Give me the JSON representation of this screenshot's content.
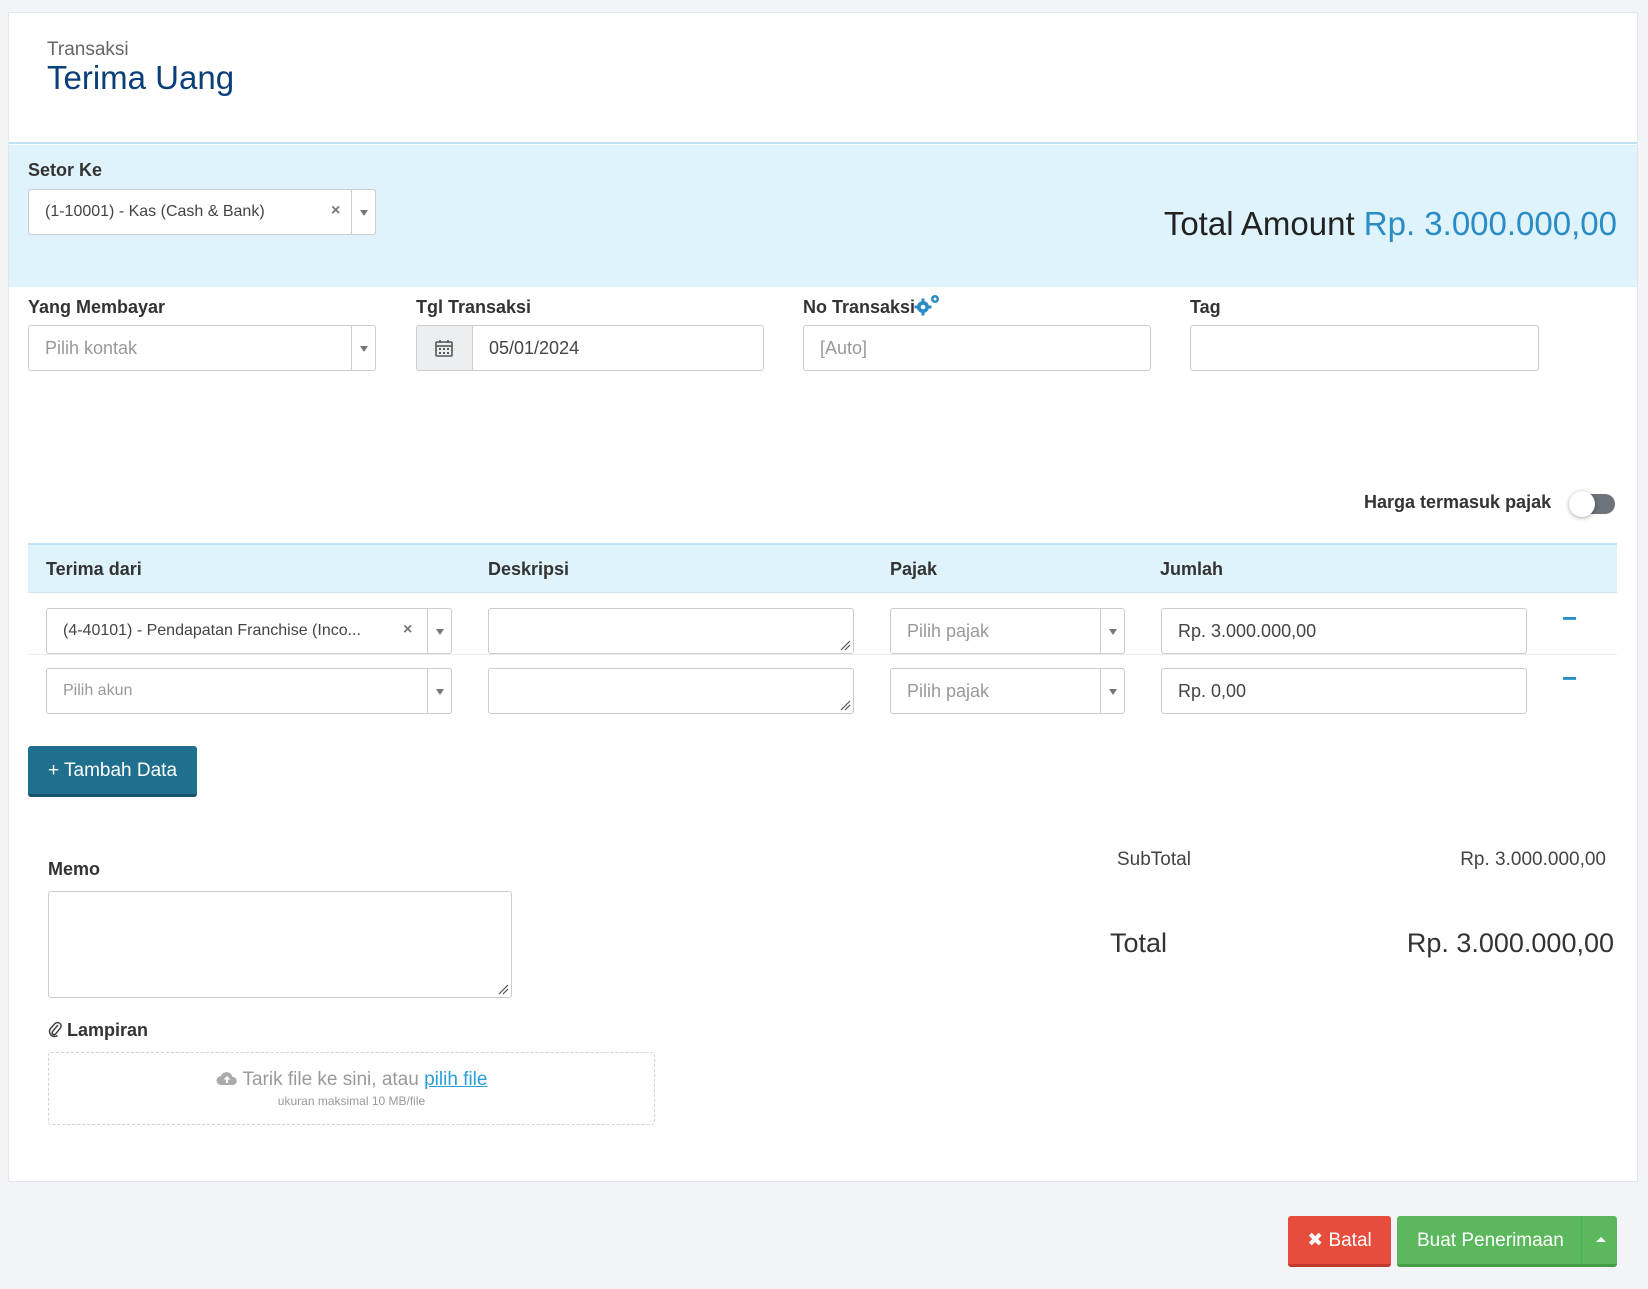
{
  "header": {
    "breadcrumb": "Transaksi",
    "title": "Terima Uang"
  },
  "deposit": {
    "label": "Setor Ke",
    "selected": "(1-10001) - Kas (Cash & Bank)",
    "total_amount_label": "Total Amount",
    "total_amount_value": "Rp. 3.000.000,00"
  },
  "fields": {
    "payer": {
      "label": "Yang Membayar",
      "placeholder": "Pilih kontak"
    },
    "date": {
      "label": "Tgl Transaksi",
      "value": "05/01/2024"
    },
    "trx_no": {
      "label": "No Transaksi",
      "placeholder": "[Auto]"
    },
    "tag": {
      "label": "Tag",
      "value": ""
    }
  },
  "tax_inclusive": {
    "label": "Harga termasuk pajak",
    "enabled": false
  },
  "table": {
    "columns": [
      "Terima dari",
      "Deskripsi",
      "Pajak",
      "Jumlah"
    ],
    "rows": [
      {
        "account": "(4-40101) - Pendapatan Franchise (Inco...",
        "description": "",
        "tax": "Pilih pajak",
        "amount": "Rp. 3.000.000,00"
      },
      {
        "account": "Pilih akun",
        "description": "",
        "tax": "Pilih pajak",
        "amount": "Rp. 0,00"
      }
    ]
  },
  "add_button": "+ Tambah Data",
  "memo": {
    "label": "Memo",
    "value": ""
  },
  "attachment": {
    "label": "Lampiran",
    "drop_text": "Tarik file ke sini, atau",
    "pick_link": "pilih file",
    "max_size": "ukuran maksimal 10 MB/file"
  },
  "summary": {
    "subtotal_label": "SubTotal",
    "subtotal_value": "Rp. 3.000.000,00",
    "total_label": "Total",
    "total_value": "Rp. 3.000.000,00"
  },
  "actions": {
    "cancel": "Batal",
    "submit": "Buat Penerimaan"
  },
  "colors": {
    "title": "#0b3f7a",
    "accent": "#2a8cc4",
    "band": "#def3fb",
    "primary_button": "#1f6f8f",
    "cancel_button": "#e74c3c",
    "submit_button": "#5cb85c"
  },
  "icons": [
    "calendar-icon",
    "gears-icon",
    "clear-icon",
    "minus-icon",
    "paperclip-icon",
    "cloud-upload-icon",
    "close-icon",
    "caret-up-icon"
  ]
}
